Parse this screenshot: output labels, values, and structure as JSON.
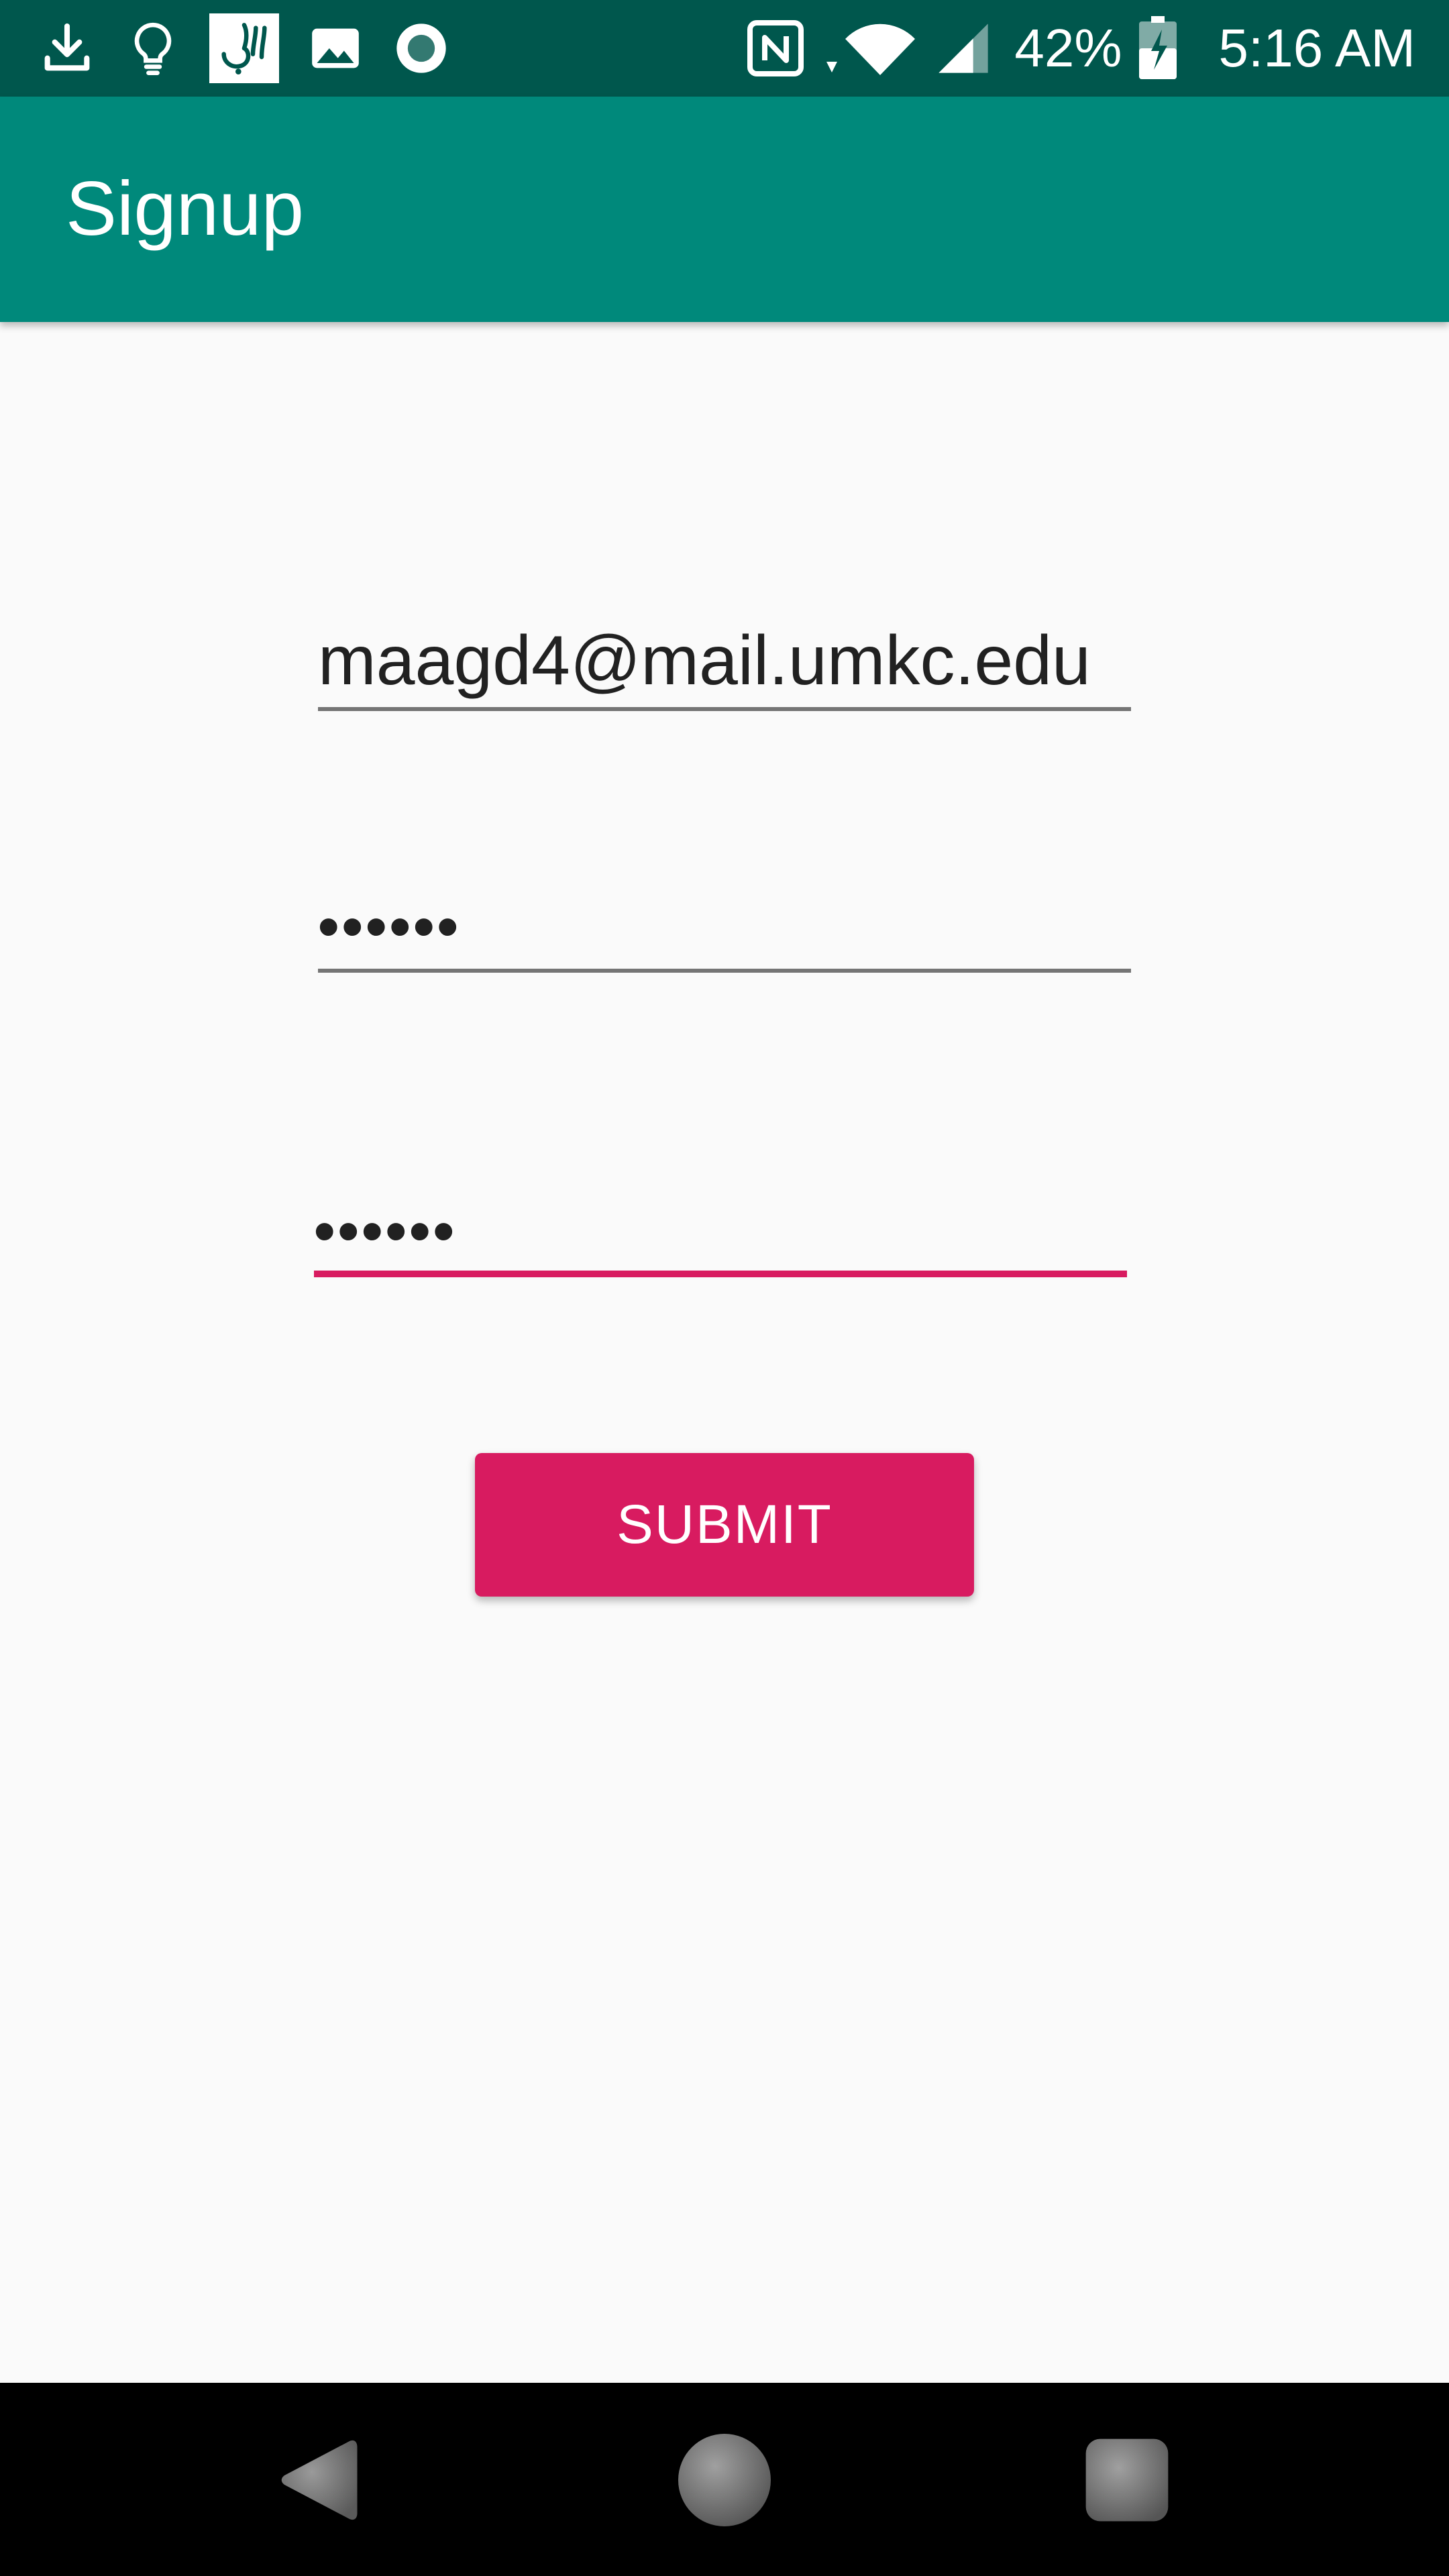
{
  "status_bar": {
    "battery_percent": "42%",
    "time": "5:16 AM",
    "left_icons": [
      "download-icon",
      "lightbulb-icon",
      "app-logo-icon",
      "image-icon",
      "record-icon"
    ],
    "right_icons": [
      "nfc-icon",
      "wifi-icon",
      "cell-signal-icon",
      "battery-charging-icon"
    ]
  },
  "app_bar": {
    "title": "Signup"
  },
  "form": {
    "email_value": "maagd4@mail.umkc.edu",
    "password_value": "••••••",
    "confirm_password_value": "••••••",
    "submit_label": "SUBMIT"
  },
  "nav_bar": {
    "icons": [
      "back-icon",
      "home-icon",
      "recents-icon"
    ]
  },
  "colors": {
    "status_bar": "#00574d",
    "app_bar": "#00897b",
    "accent": "#d81b60",
    "background": "#fafafa"
  }
}
